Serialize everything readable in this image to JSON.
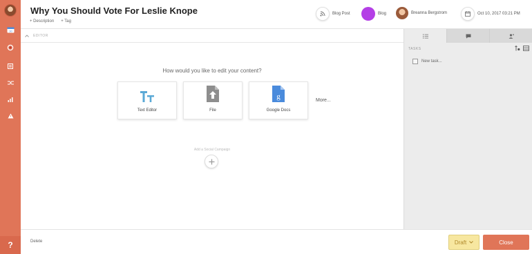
{
  "colors": {
    "rail": "#e07558",
    "blog": "#b43fe6",
    "accent_blue": "#4a8bdc",
    "draft_bg": "#f7e7a0"
  },
  "header": {
    "title": "Why You Should Vote For Leslie Knope",
    "description_link": "+ Description",
    "tag_link": "+ Tag",
    "type_label": "Blog Post",
    "channel_label": "Blog",
    "owner_label": "Breanna Bergstrom",
    "date_label": "Oct 10, 2017 03:21 PM"
  },
  "editor": {
    "section_label": "EDITOR",
    "question": "How would you like to edit your content?",
    "options": [
      {
        "label": "Text Editor",
        "icon": "text-editor-icon"
      },
      {
        "label": "File",
        "icon": "file-upload-icon"
      },
      {
        "label": "Google Docs",
        "icon": "google-docs-icon"
      }
    ],
    "more_label": "More...",
    "social_label": "Add a Social Campaign"
  },
  "panel": {
    "tasks_label": "TASKS",
    "new_task_placeholder": "New task..."
  },
  "footer": {
    "delete_label": "Delete",
    "status_label": "Draft",
    "close_label": "Close"
  },
  "rail": {
    "help_label": "?"
  }
}
